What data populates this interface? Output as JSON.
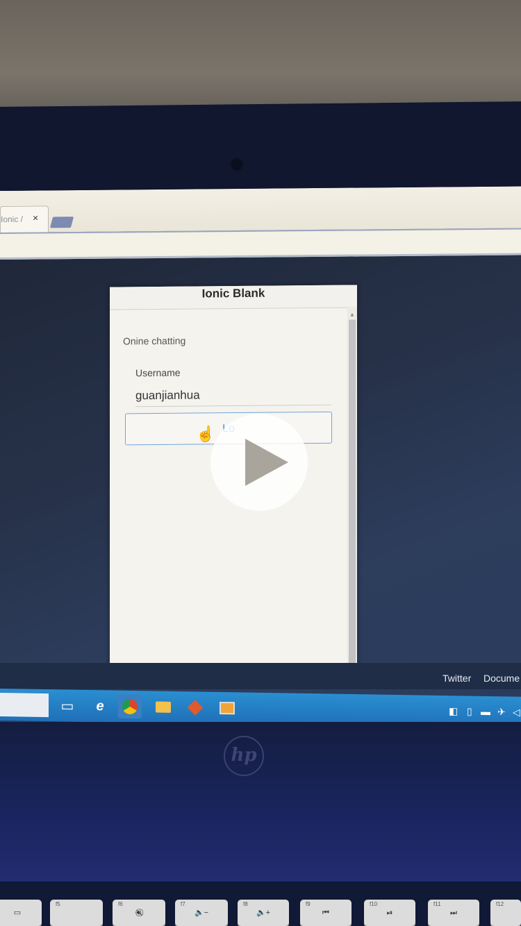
{
  "browser": {
    "tab_title": "Ionic /",
    "tab_close": "×"
  },
  "app": {
    "header_title": "Ionic Blank",
    "subtitle": "Onine chatting",
    "username_label": "Username",
    "username_value": "guanjianhua",
    "login_button_label": "Lo"
  },
  "bookmarks": {
    "items": [
      "Twitter",
      "Docume"
    ]
  },
  "taskbar": {
    "icons": [
      "task-view-icon",
      "internet-explorer-icon",
      "chrome-icon",
      "file-explorer-icon",
      "git-icon",
      "sublime-text-icon"
    ]
  },
  "tray": {
    "icons": [
      "shield-icon",
      "usb-icon",
      "battery-icon",
      "airplane-icon",
      "volume-icon"
    ]
  },
  "laptop": {
    "logo_text": "hp"
  },
  "keyboard": {
    "keys": [
      {
        "fn": "",
        "label": "▭"
      },
      {
        "fn": "f5",
        "label": ""
      },
      {
        "fn": "f6",
        "label": "🔊⃠"
      },
      {
        "fn": "f7",
        "label": "🔈−"
      },
      {
        "fn": "f8",
        "label": "🔈+"
      },
      {
        "fn": "f9",
        "label": "⏮"
      },
      {
        "fn": "f10",
        "label": "⏯"
      },
      {
        "fn": "f11",
        "label": "⏭"
      },
      {
        "fn": "f12",
        "label": ""
      }
    ]
  },
  "colors": {
    "accent_blue": "#4a90d6",
    "taskbar_blue": "#1f6fb7",
    "bezel_navy": "#10172e"
  }
}
